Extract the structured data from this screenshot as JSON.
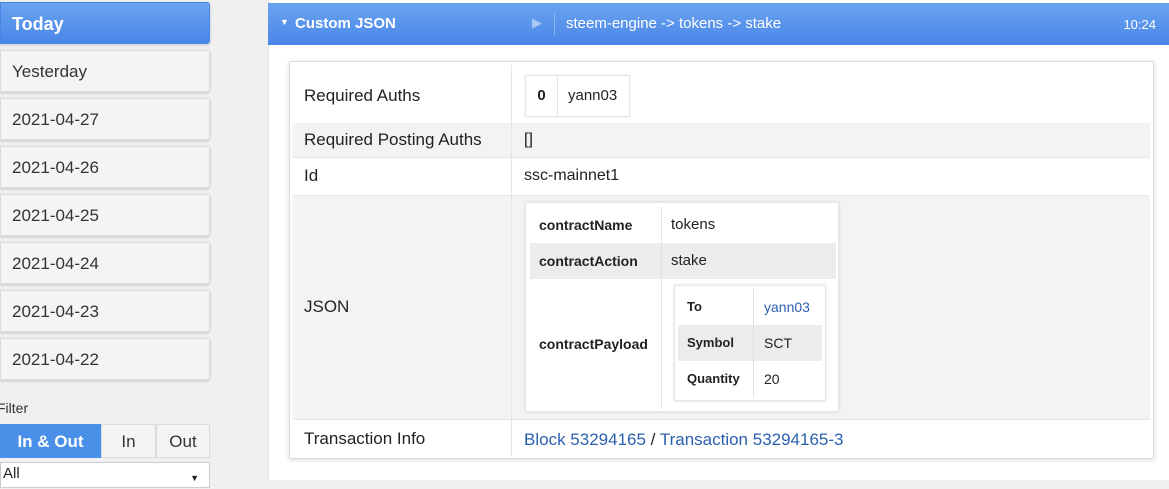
{
  "sidebar": {
    "days": [
      "Today",
      "Yesterday",
      "2021-04-27",
      "2021-04-26",
      "2021-04-25",
      "2021-04-24",
      "2021-04-23",
      "2021-04-22"
    ],
    "filter_label": "Filter",
    "filter_tabs": [
      "In & Out",
      "In",
      "Out"
    ],
    "select_value": "All"
  },
  "operation": {
    "title": "Custom JSON",
    "path": "steem-engine -> tokens -> stake",
    "time": "10:24",
    "rows": {
      "required_auths": {
        "label": "Required Auths",
        "index": "0",
        "account": "yann03"
      },
      "required_posting_auths": {
        "label": "Required Posting Auths",
        "value": "[]"
      },
      "id": {
        "label": "Id",
        "value": "ssc-mainnet1"
      },
      "json": {
        "label": "JSON",
        "contract_name_key": "contractName",
        "contract_name": "tokens",
        "contract_action_key": "contractAction",
        "contract_action": "stake",
        "contract_payload_key": "contractPayload",
        "payload": {
          "to_key": "To",
          "to": "yann03",
          "symbol_key": "Symbol",
          "symbol": "SCT",
          "quantity_key": "Quantity",
          "quantity": "20"
        }
      },
      "transaction_info": {
        "label": "Transaction Info",
        "block": "Block 53294165",
        "separator": "/",
        "transaction": "Transaction 53294165-3"
      }
    }
  },
  "colors": {
    "accent": "#4a86e8",
    "link": "#2b5fb0"
  }
}
